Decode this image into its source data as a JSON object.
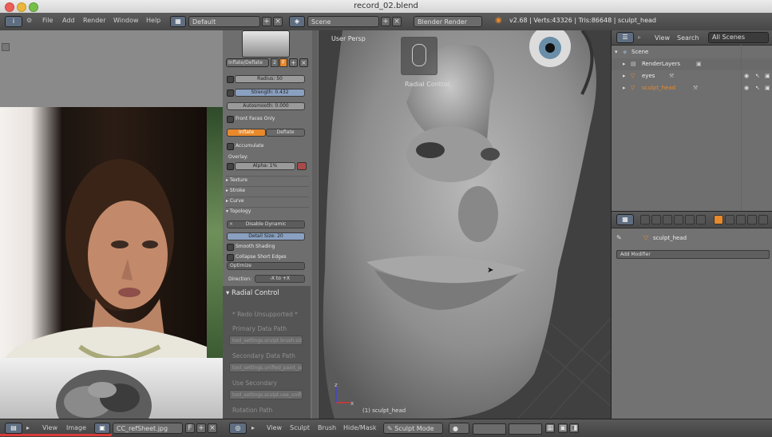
{
  "window": {
    "title": "record_02.blend"
  },
  "top_menu": {
    "items": [
      "File",
      "Add",
      "Render",
      "Window",
      "Help"
    ]
  },
  "screen_layout": "Default",
  "scene_name": "Scene",
  "render_engine": "Blender Render",
  "stats": "v2.68 | Verts:43326 | Tris:86648 | sculpt_head",
  "toolshelf": {
    "brush_name": "Inflate/Deflate",
    "brush_users": "2",
    "brush_fake_user": "F",
    "radius": "Radius: 50",
    "strength": "Strength: 0.432",
    "autosmooth": "Autosmooth: 0.000",
    "front_faces_only": "Front Faces Only",
    "inflate": "Inflate",
    "deflate": "Deflate",
    "accumulate": "Accumulate",
    "overlay": "Overlay:",
    "alpha": "Alpha: 1%",
    "panels": [
      "Texture",
      "Stroke",
      "Curve",
      "Topology"
    ],
    "disable_dynamic": "Disable Dynamic",
    "detail_size": "Detail Size: 20",
    "smooth_shading": "Smooth Shading",
    "collapse_short_edges": "Collapse Short Edges",
    "optimize": "Optimize",
    "direction_label": "Direction:",
    "direction_value": "-X to +X"
  },
  "redo_panel": {
    "title": "Radial Control",
    "redo_unsupported": "* Redo Unsupported *",
    "primary_label": "Primary Data Path",
    "primary_value": "tool_settings.sculpt.brush.size",
    "secondary_label": "Secondary Data Path",
    "secondary_value": "tool_settings.unified_paint_settings.size",
    "use_secondary_label": "Use Secondary",
    "use_secondary_value": "tool_settings.sculpt.use_unified_size",
    "rotation_label": "Rotation Path"
  },
  "viewport": {
    "view_label": "User Persp",
    "operator_label": "Radial Control",
    "object_label": "(1) sculpt_head"
  },
  "outliner": {
    "header_items": [
      "View",
      "Search"
    ],
    "scenes_select": "All Scenes",
    "tree": [
      {
        "name": "Scene",
        "level": 0,
        "selected": false
      },
      {
        "name": "RenderLayers",
        "level": 1,
        "selected": false
      },
      {
        "name": "eyes",
        "level": 1,
        "selected": false
      },
      {
        "name": "sculpt_head",
        "level": 1,
        "selected": true
      }
    ]
  },
  "properties": {
    "object_name": "sculpt_head",
    "add_modifier": "Add Modifier"
  },
  "image_editor_bar": {
    "items": [
      "View",
      "Image"
    ],
    "image_name": "CC_refSheet.jpg"
  },
  "viewport_bar": {
    "items": [
      "View",
      "Sculpt",
      "Brush",
      "Hide/Mask"
    ],
    "mode": "Sculpt Mode"
  },
  "colors": {
    "accent_orange": "#e8892b",
    "selection_blue": "#5680c2",
    "header_gray": "#4a4a4a"
  }
}
